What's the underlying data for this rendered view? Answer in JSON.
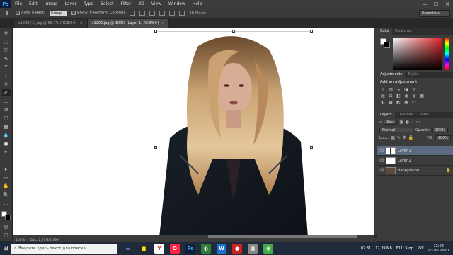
{
  "menubar": {
    "logo": "Ps",
    "items": [
      "File",
      "Edit",
      "Image",
      "Layer",
      "Type",
      "Select",
      "Filter",
      "3D",
      "View",
      "Window",
      "Help"
    ],
    "win_min": "—",
    "win_max": "☐",
    "win_close": "✕"
  },
  "options": {
    "auto_select_label": "Auto-Select:",
    "auto_select_value": "Group",
    "transform_controls_label": "Show Transform Controls",
    "mode_3d": "3D Mode:",
    "workspace": "Essentials"
  },
  "tabs": [
    {
      "label": "s1200 (1).jpg @ 66,7% (RGB/8#)"
    },
    {
      "label": "s1200.jpg @ 100% (Layer 1, RGB/8#)"
    }
  ],
  "tab_close": "×",
  "status": {
    "zoom": "100%",
    "doc": "Doc: 2,75M/4,39M"
  },
  "panels": {
    "color_tabs": [
      "Color",
      "Swatches"
    ],
    "adj_tabs": [
      "Adjustments",
      "Styles"
    ],
    "adj_title": "Add an adjustment",
    "layers_tabs": [
      "Layers",
      "Channels",
      "Paths"
    ],
    "kind": "Kind",
    "blend_mode": "Normal",
    "opacity_label": "Opacity:",
    "opacity_value": "100%",
    "lock_label": "Lock:",
    "fill_label": "Fill:",
    "fill_value": "100%",
    "layers": [
      {
        "name": "Layer 1",
        "selected": true
      },
      {
        "name": "Layer 2",
        "selected": false
      },
      {
        "name": "Background",
        "selected": false
      }
    ]
  },
  "taskbar": {
    "search_placeholder": "Введите здесь текст для поиска",
    "tray_time_left": "02:31",
    "tray_mb": "12,39 МБ",
    "tray_hint": "F11: Stop",
    "lang": "РУС",
    "time": "13:02",
    "date": "03.06.2020"
  },
  "colors": {
    "accent": "#31a8ff",
    "selected_layer": "#5b6a80"
  }
}
